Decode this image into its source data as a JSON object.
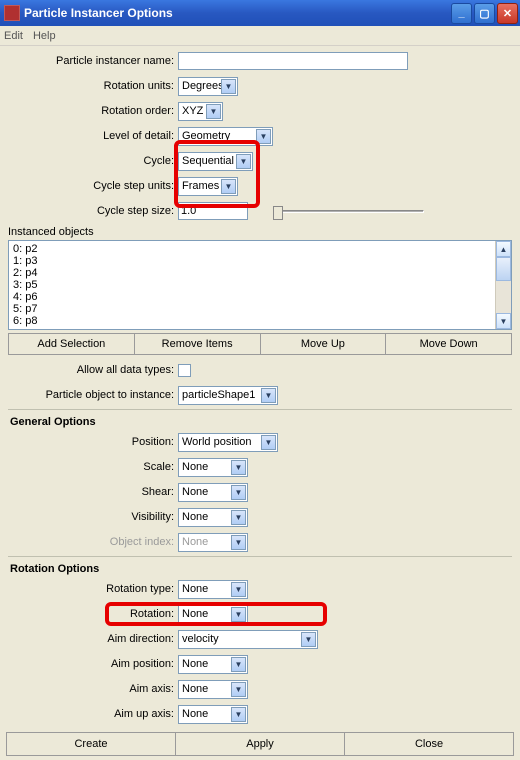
{
  "window": {
    "title": "Particle Instancer Options"
  },
  "menu": {
    "edit": "Edit",
    "help": "Help"
  },
  "labels": {
    "name": "Particle instancer name:",
    "rotUnits": "Rotation units:",
    "rotOrder": "Rotation order:",
    "lod": "Level of detail:",
    "cycle": "Cycle:",
    "cycleUnits": "Cycle step units:",
    "cycleSize": "Cycle step size:",
    "instanced": "Instanced objects",
    "allowAll": "Allow all data types:",
    "partObj": "Particle object to instance:"
  },
  "values": {
    "name": "",
    "rotUnits": "Degrees",
    "rotOrder": "XYZ",
    "lod": "Geometry",
    "cycle": "Sequential",
    "cycleUnits": "Frames",
    "cycleSize": "1.0",
    "partObj": "particleShape1"
  },
  "list": [
    "0: p2",
    "1: p3",
    "2: p4",
    "3: p5",
    "4: p6",
    "5: p7",
    "6: p8"
  ],
  "btns": {
    "addSel": "Add Selection",
    "remove": "Remove Items",
    "moveUp": "Move Up",
    "moveDown": "Move Down",
    "create": "Create",
    "apply": "Apply",
    "close": "Close"
  },
  "groups": {
    "general": "General Options",
    "rotation": "Rotation Options"
  },
  "general": {
    "labels": {
      "position": "Position:",
      "scale": "Scale:",
      "shear": "Shear:",
      "visibility": "Visibility:",
      "objIndex": "Object index:"
    },
    "values": {
      "position": "World position",
      "scale": "None",
      "shear": "None",
      "visibility": "None",
      "objIndex": "None"
    }
  },
  "rotation": {
    "labels": {
      "type": "Rotation type:",
      "rot": "Rotation:",
      "aimDir": "Aim direction:",
      "aimPos": "Aim position:",
      "aimAxis": "Aim axis:",
      "aimUp": "Aim up axis:"
    },
    "values": {
      "type": "None",
      "rot": "None",
      "aimDir": "velocity",
      "aimPos": "None",
      "aimAxis": "None",
      "aimUp": "None"
    }
  }
}
